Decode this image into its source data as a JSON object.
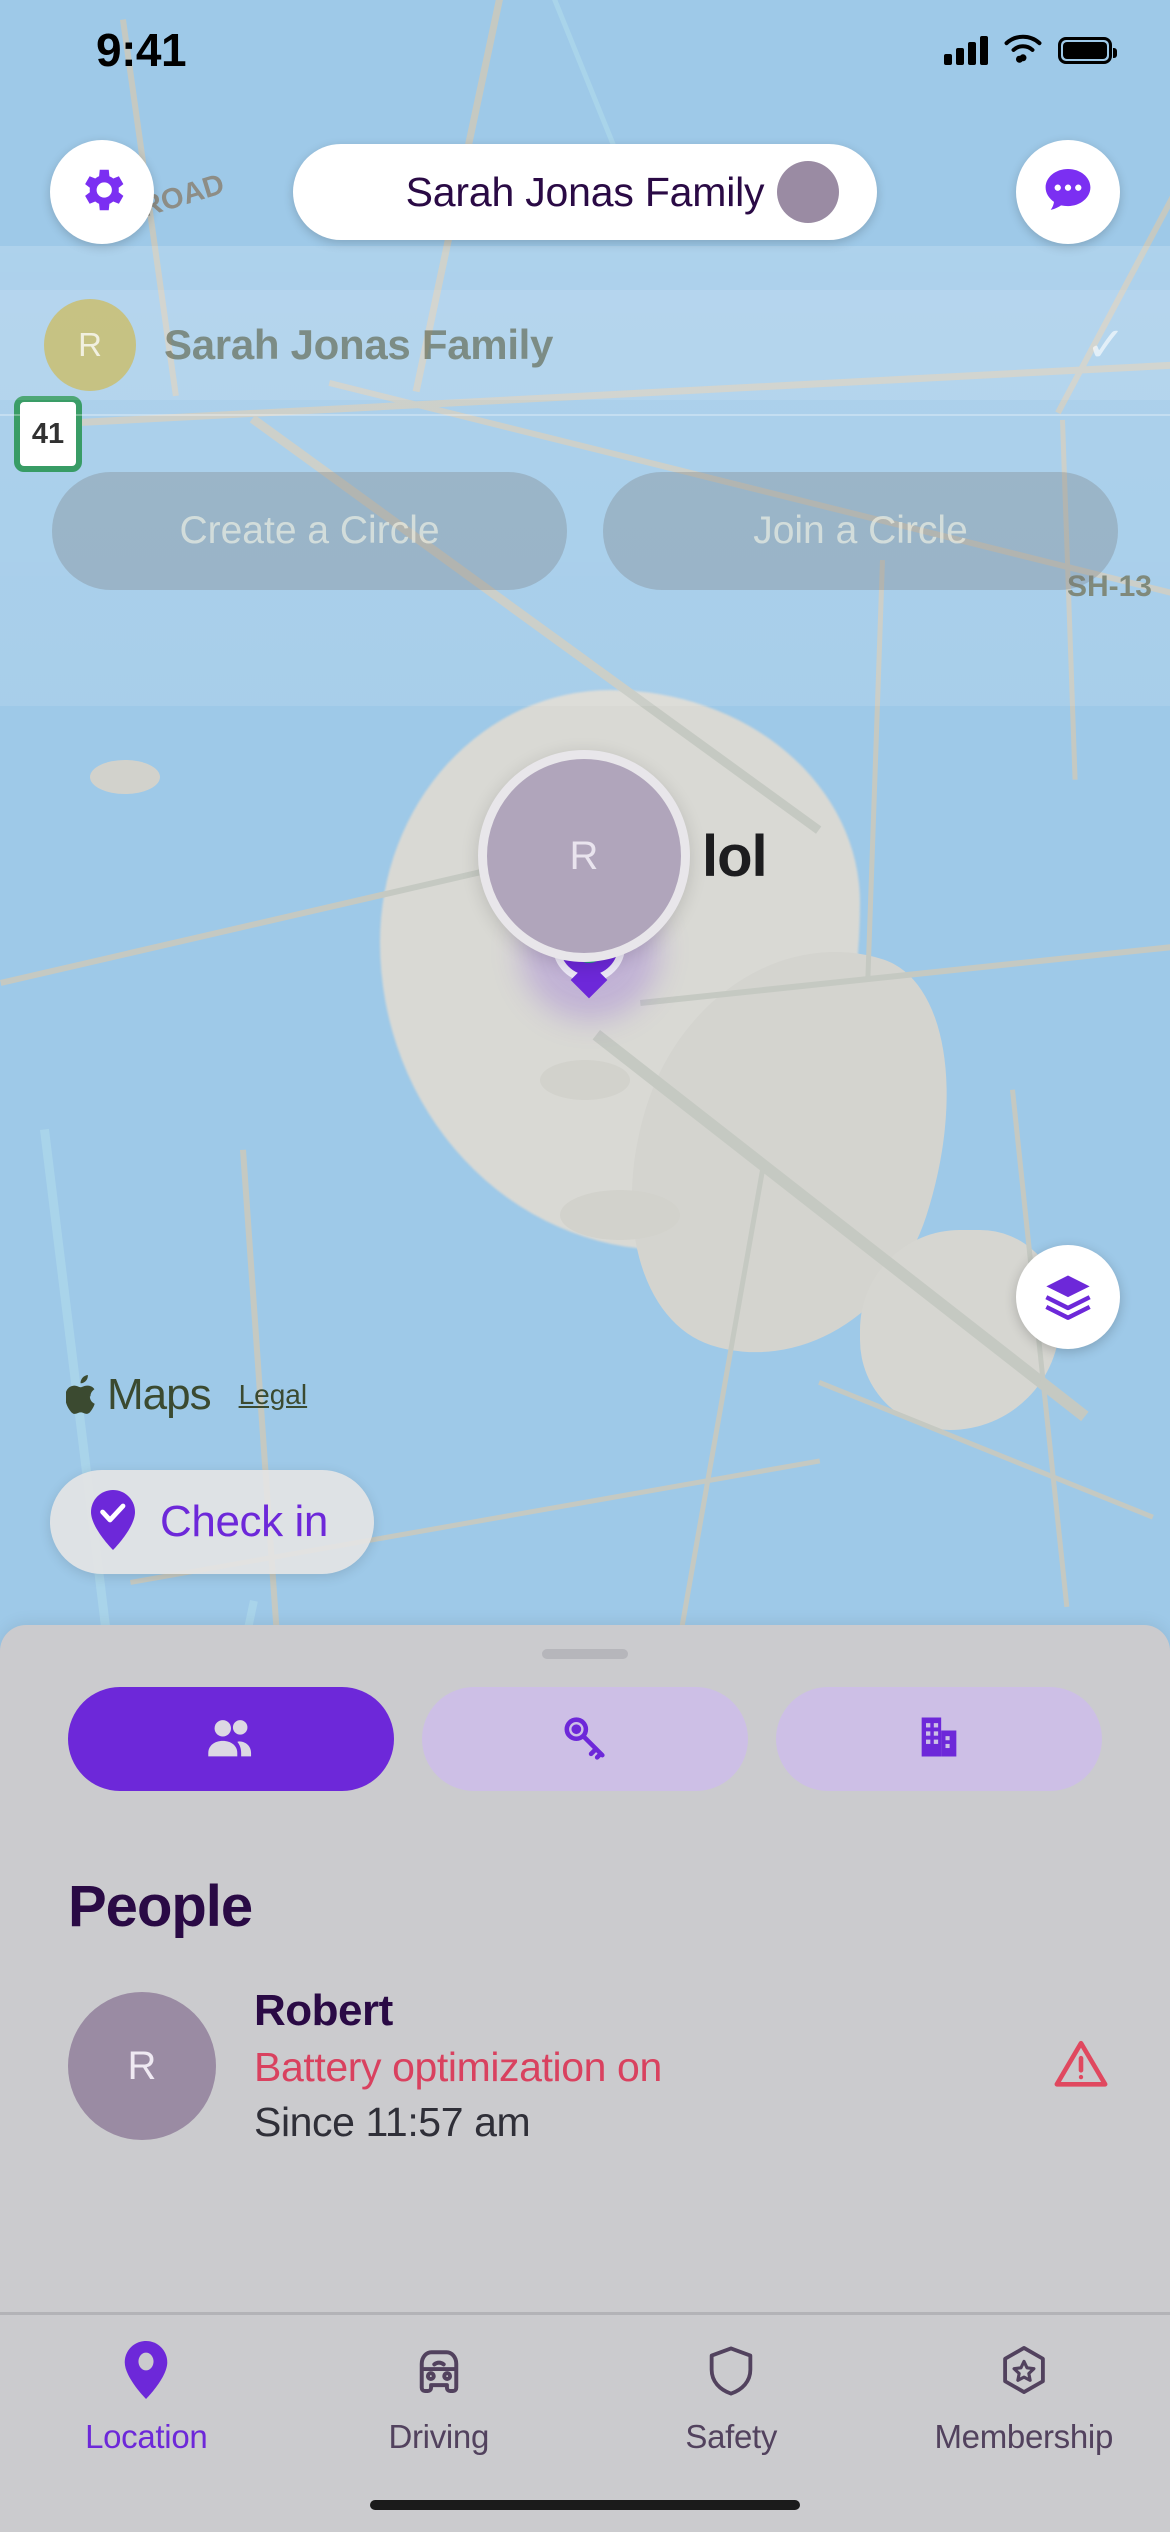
{
  "status_bar": {
    "time": "9:41",
    "signal_icon": "cellular-signal-icon",
    "wifi_icon": "wifi-icon",
    "battery_icon": "battery-full-icon"
  },
  "top_nav": {
    "settings_icon": "gear-icon",
    "circle_name": "Sarah Jonas Family",
    "circle_avatar_initial": "",
    "messages_icon": "chat-bubble-icon"
  },
  "circle_switcher": {
    "rows": [
      {
        "initial": "R",
        "name": "Sarah Jonas Family",
        "selected_icon": "checkmark-icon"
      }
    ],
    "create_label": "Create a Circle",
    "join_label": "Join a Circle"
  },
  "map": {
    "road_label": "ROAD",
    "highway_shield": "41",
    "highway_label": "SH-13",
    "member_marker": {
      "initial": "R",
      "label": "lol"
    },
    "layers_icon": "map-layers-icon",
    "attribution": {
      "apple_icon": "apple-logo-icon",
      "maps": "Maps",
      "legal": "Legal"
    },
    "check_in": {
      "icon": "check-pin-icon",
      "label": "Check in"
    }
  },
  "sheet": {
    "tabs": [
      {
        "id": "people",
        "icon": "people-icon",
        "active": true
      },
      {
        "id": "places",
        "icon": "key-icon",
        "active": false
      },
      {
        "id": "buildings",
        "icon": "building-icon",
        "active": false
      }
    ],
    "section_title": "People",
    "people": [
      {
        "initial": "R",
        "name": "Robert",
        "status": "Battery optimization on",
        "since": "Since 11:57 am",
        "warning_icon": "warning-triangle-icon"
      }
    ]
  },
  "tab_bar": {
    "items": [
      {
        "label": "Location",
        "icon": "location-pin-icon",
        "active": true
      },
      {
        "label": "Driving",
        "icon": "car-icon",
        "active": false
      },
      {
        "label": "Safety",
        "icon": "shield-icon",
        "active": false
      },
      {
        "label": "Membership",
        "icon": "star-badge-icon",
        "active": false
      }
    ]
  },
  "colors": {
    "accent_purple": "#6d28d9",
    "dark_purple": "#2a0a45",
    "alert_red": "#d9415f",
    "sheet_grey": "#cbcbce",
    "map_green": "#bdd191"
  }
}
